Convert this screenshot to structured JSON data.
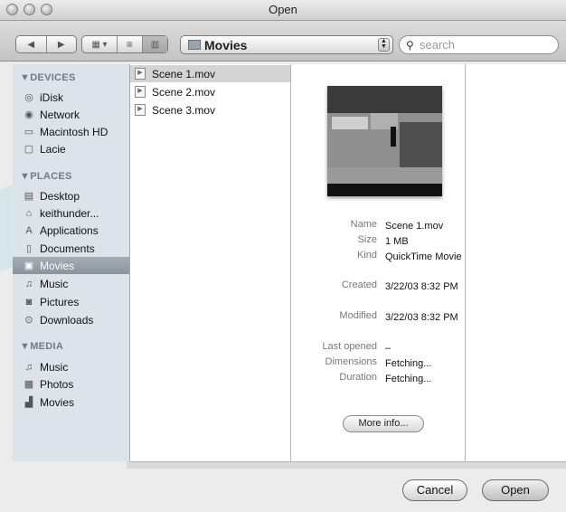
{
  "window": {
    "title": "Open"
  },
  "toolbar": {
    "back_icon": "back-arrow-icon",
    "forward_icon": "forward-arrow-icon",
    "view_icons": [
      "icon-view-icon",
      "list-view-icon",
      "column-view-icon"
    ],
    "location": "Movies",
    "search_placeholder": "search"
  },
  "sidebar": {
    "sections": [
      {
        "title": "DEVICES",
        "items": [
          {
            "label": "iDisk",
            "icon": "idisk-icon"
          },
          {
            "label": "Network",
            "icon": "network-icon"
          },
          {
            "label": "Macintosh HD",
            "icon": "harddisk-icon"
          },
          {
            "label": "Lacie",
            "icon": "external-disk-icon"
          }
        ]
      },
      {
        "title": "PLACES",
        "items": [
          {
            "label": "Desktop",
            "icon": "desktop-icon"
          },
          {
            "label": "keithunder...",
            "icon": "home-icon"
          },
          {
            "label": "Applications",
            "icon": "applications-icon"
          },
          {
            "label": "Documents",
            "icon": "documents-icon"
          },
          {
            "label": "Movies",
            "icon": "movies-folder-icon",
            "selected": true
          },
          {
            "label": "Music",
            "icon": "music-icon"
          },
          {
            "label": "Pictures",
            "icon": "pictures-icon"
          },
          {
            "label": "Downloads",
            "icon": "downloads-icon"
          }
        ]
      },
      {
        "title": "MEDIA",
        "items": [
          {
            "label": "Music",
            "icon": "music-icon"
          },
          {
            "label": "Photos",
            "icon": "photos-icon"
          },
          {
            "label": "Movies",
            "icon": "movies-icon"
          }
        ]
      }
    ]
  },
  "files": [
    {
      "name": "Scene 1.mov",
      "selected": true
    },
    {
      "name": "Scene 2.mov"
    },
    {
      "name": "Scene 3.mov"
    }
  ],
  "preview": {
    "fields": [
      {
        "key": "Name",
        "value": "Scene 1.mov"
      },
      {
        "key": "Size",
        "value": "1 MB"
      },
      {
        "key": "Kind",
        "value": "QuickTime Movie"
      },
      {
        "key": "Created",
        "value": "3/22/03 8:32 PM"
      },
      {
        "key": "Modified",
        "value": "3/22/03 8:32 PM"
      },
      {
        "key": "Last opened",
        "value": "–"
      },
      {
        "key": "Dimensions",
        "value": "Fetching..."
      },
      {
        "key": "Duration",
        "value": "Fetching..."
      }
    ],
    "more_info_label": "More info..."
  },
  "buttons": {
    "cancel": "Cancel",
    "open": "Open"
  }
}
